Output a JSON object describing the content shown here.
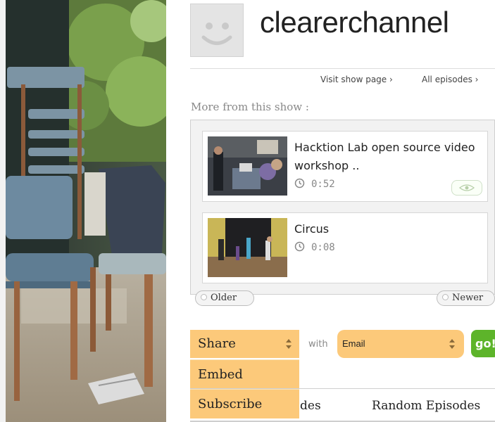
{
  "video": {
    "description_icon": "video-frame-still"
  },
  "header": {
    "channel_name": "clearerchannel",
    "avatar_icon": "smiley-face-icon",
    "visit_show_page": "Visit show page ›",
    "all_episodes": "All episodes ›"
  },
  "more_from_show": {
    "title": "More from this show :",
    "episodes": [
      {
        "title": "Hacktion Lab open source video workshop ..",
        "duration": "0:52"
      },
      {
        "title": "Circus",
        "duration": "0:08"
      }
    ],
    "older_label": "Older",
    "newer_label": "Newer"
  },
  "share": {
    "selected": "Share",
    "menu_items": [
      "Embed",
      "Subscribe"
    ],
    "with_label": "with",
    "method_selected": "Email",
    "go_label": "go!"
  },
  "tabs": {
    "partial_tab": "des",
    "random_episodes": "Random Episodes"
  },
  "colors": {
    "accent_orange": "#fcc97a",
    "go_green": "#5db42a",
    "panel_bg": "#f2f2f2"
  }
}
